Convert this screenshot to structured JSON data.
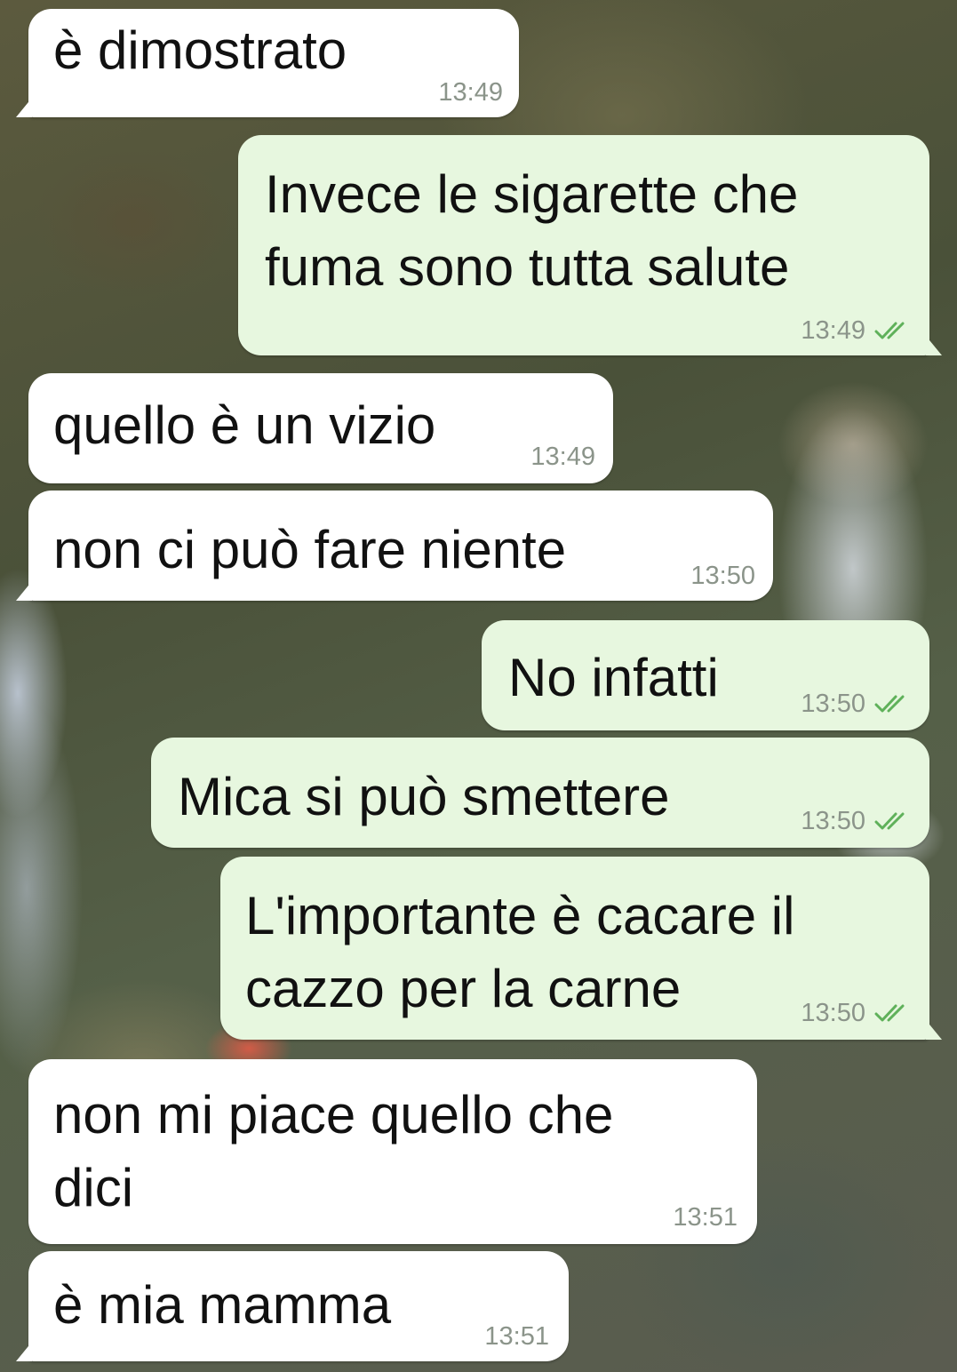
{
  "conversation": {
    "messages": [
      {
        "direction": "incoming",
        "text": "è dimostrato",
        "time": "13:49",
        "read": false
      },
      {
        "direction": "outgoing",
        "text": "Invece le sigarette che\nfuma sono tutta salute",
        "time": "13:49",
        "read": true
      },
      {
        "direction": "incoming",
        "text": "quello è un vizio",
        "time": "13:49",
        "read": false
      },
      {
        "direction": "incoming",
        "text": "non ci può fare niente",
        "time": "13:50",
        "read": false
      },
      {
        "direction": "outgoing",
        "text": "No infatti",
        "time": "13:50",
        "read": true
      },
      {
        "direction": "outgoing",
        "text": "Mica si può smettere",
        "time": "13:50",
        "read": true
      },
      {
        "direction": "outgoing",
        "text": "L'importante è cacare il\ncazzo per la carne",
        "time": "13:50",
        "read": true
      },
      {
        "direction": "incoming",
        "text": "non mi piace quello che\ndici",
        "time": "13:51",
        "read": false
      },
      {
        "direction": "incoming",
        "text": "è mia mamma",
        "time": "13:51",
        "read": false
      }
    ]
  },
  "theme": {
    "incoming_bubble": "#ffffff",
    "outgoing_bubble": "#e7f7df",
    "timestamp_color": "#8b948a",
    "read_receipt_color": "#5fb15a",
    "read_receipt_icon": "double-check-icon"
  }
}
